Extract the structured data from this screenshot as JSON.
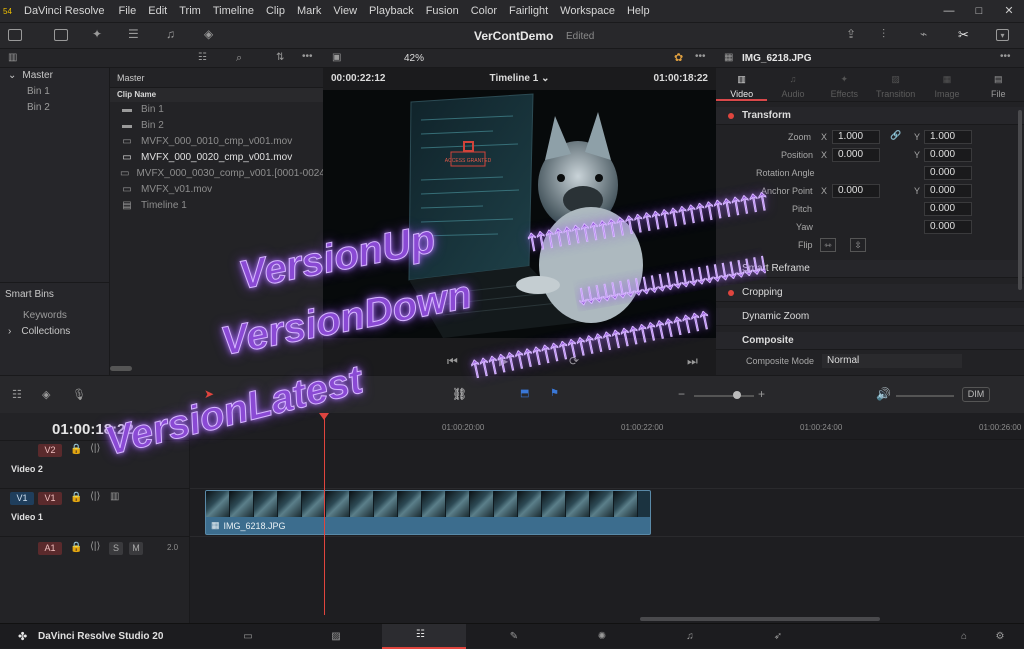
{
  "titlebar": {
    "gpu_badge": "54",
    "app_name": "DaVinci Resolve",
    "menu": [
      "File",
      "Edit",
      "Trim",
      "Timeline",
      "Clip",
      "Mark",
      "View",
      "Playback",
      "Fusion",
      "Color",
      "Fairlight",
      "Workspace",
      "Help"
    ],
    "minimize": "—",
    "maximize": "□",
    "close": "✕"
  },
  "toolbar": {
    "project_title": "VerContDemo",
    "status": "Edited",
    "zoom": "42%"
  },
  "bins": {
    "root": "Master",
    "items": [
      "Bin 1",
      "Bin 2"
    ],
    "smart_bins_title": "Smart Bins",
    "smart_items": [
      "Keywords",
      "Collections"
    ]
  },
  "media_pool": {
    "header": "Master",
    "column": "Clip Name",
    "rows": [
      {
        "icon": "folder-icon",
        "name": "Bin 1"
      },
      {
        "icon": "folder-icon",
        "name": "Bin 2"
      },
      {
        "icon": "clip-icon",
        "name": "MVFX_000_0010_cmp_v001.mov"
      },
      {
        "icon": "clip-icon",
        "name": "MVFX_000_0020_cmp_v001.mov"
      },
      {
        "icon": "clip-icon",
        "name": "MVFX_000_0030_comp_v001.[0001-0024].exr"
      },
      {
        "icon": "clip-icon",
        "name": "MVFX_v01.mov"
      },
      {
        "icon": "timeline-icon",
        "name": "Timeline 1"
      }
    ]
  },
  "viewer": {
    "timecode_left": "00:00:22:12",
    "timeline_name": "Timeline 1",
    "timecode_right": "01:00:18:22",
    "screen_text": "ACCESS GRANTED"
  },
  "inspector": {
    "clip_name": "IMG_6218.JPG",
    "tabs": [
      "Video",
      "Audio",
      "Effects",
      "Transition",
      "Image",
      "File"
    ],
    "transform": {
      "title": "Transform",
      "zoom_label": "Zoom",
      "zoom_x": "1.000",
      "zoom_y": "1.000",
      "position_label": "Position",
      "pos_x": "0.000",
      "pos_y": "0.000",
      "rotation_label": "Rotation Angle",
      "rotation": "0.000",
      "anchor_label": "Anchor Point",
      "anchor_x": "0.000",
      "anchor_y": "0.000",
      "pitch_label": "Pitch",
      "pitch": "0.000",
      "yaw_label": "Yaw",
      "yaw": "0.000",
      "flip_label": "Flip",
      "x": "X",
      "y": "Y"
    },
    "sections": [
      "Smart Reframe",
      "Cropping",
      "Dynamic Zoom",
      "Composite"
    ],
    "composite_mode_label": "Composite Mode",
    "composite_mode": "Normal"
  },
  "timeline_toolbar": {
    "dim": "DIM"
  },
  "timeline": {
    "timecode": "01:00:18:22",
    "ticks": [
      "01:00:20:00",
      "01:00:22:00",
      "01:00:24:00",
      "01:00:26:00"
    ],
    "tracks": [
      {
        "id": "V2",
        "name": "Video 2"
      },
      {
        "id": "V1",
        "name": "Video 1",
        "src": "V1"
      },
      {
        "id": "A1",
        "level": "2.0",
        "solo": "S",
        "mute": "M"
      }
    ],
    "clip_name": "IMG_6218.JPG"
  },
  "pagebar": {
    "brand": "DaVinci Resolve Studio 20"
  },
  "overlay": {
    "line1": "VersionUp",
    "line2": "VersionDown",
    "line3": "VersionLatest",
    "arrows_up": "↑↑↑↑↑↑↑↑↑↑↑↑↑↑↑↑↑↑↑↑↑↑↑↑↑↑↑",
    "arrows_down": "↓↓↓↓↓↓↓↓↓↓↓↓↓↓↓↓↓↓↓↓↓↓↓↓"
  },
  "colors": {
    "accent": "#e0453e",
    "overlay": "#8a4ad4",
    "clip": "#3c6d8e"
  }
}
